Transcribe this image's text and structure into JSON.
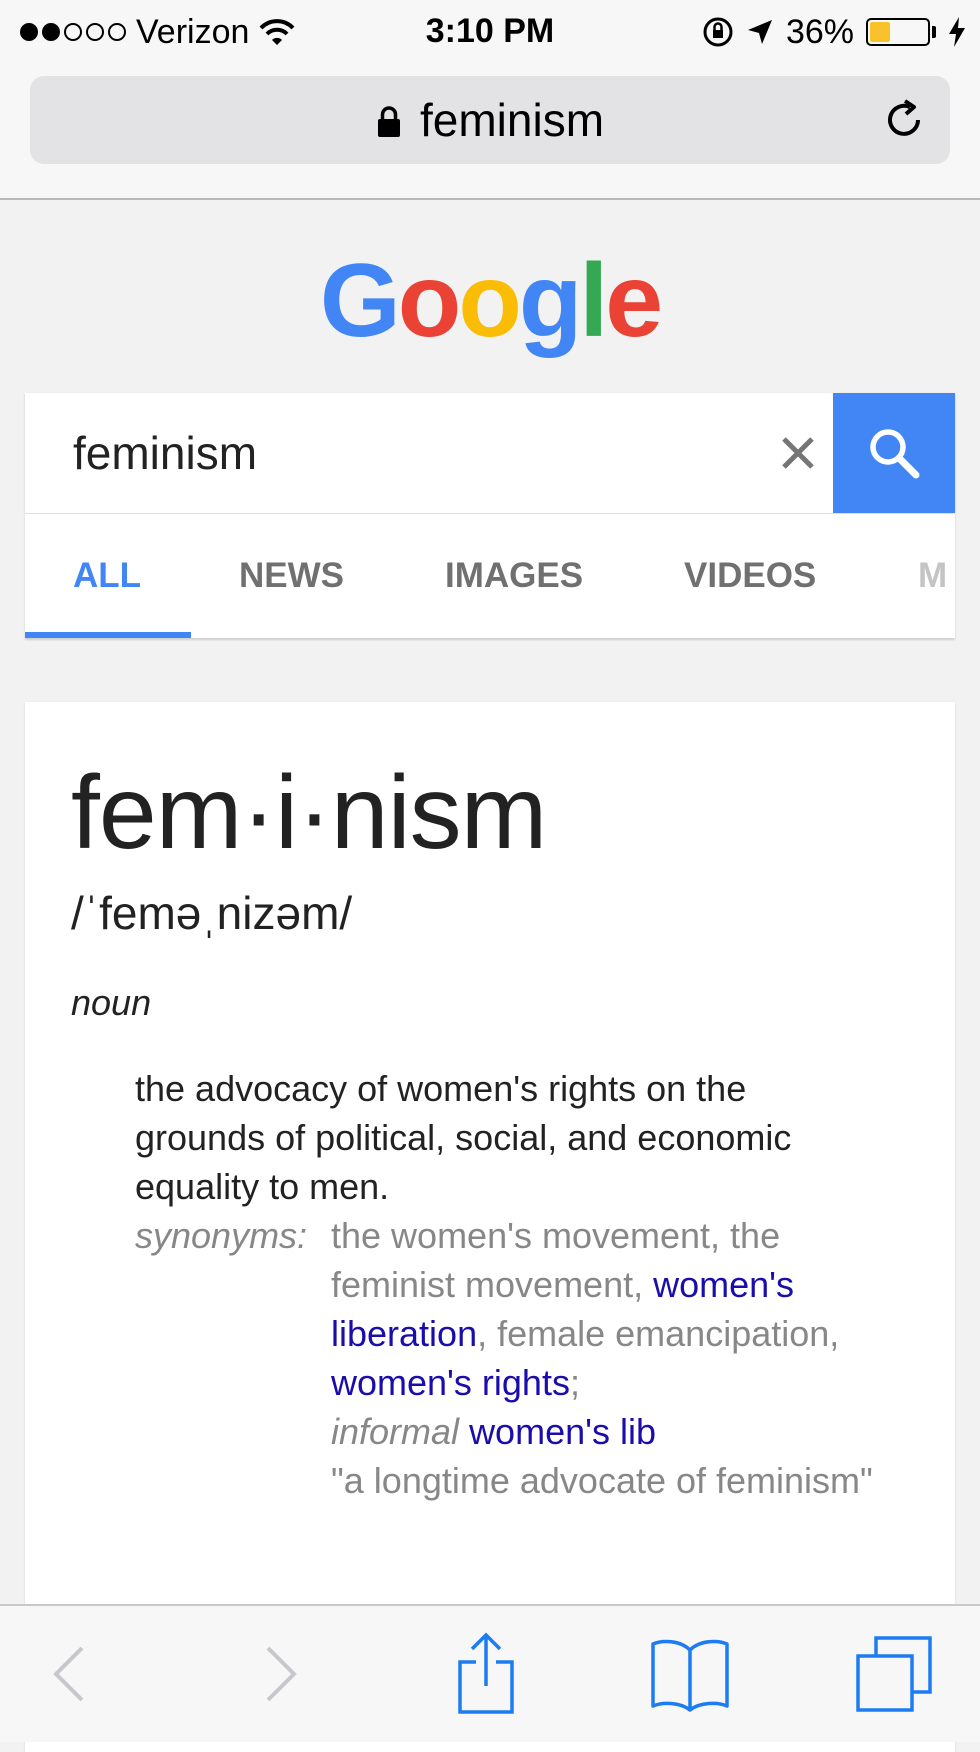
{
  "status_bar": {
    "carrier": "Verizon",
    "signal_strength": 2,
    "signal_total": 5,
    "time": "3:10 PM",
    "battery_percent_text": "36%",
    "battery_level": 0.36,
    "battery_color": "#f7c22b"
  },
  "url_bar": {
    "text": "feminism"
  },
  "logo": {
    "letters": [
      "G",
      "o",
      "o",
      "g",
      "l",
      "e"
    ],
    "colors": [
      "#4285f4",
      "#ea4335",
      "#fbbc05",
      "#4285f4",
      "#34a853",
      "#ea4335"
    ]
  },
  "search": {
    "query": "feminism",
    "accent_color": "#4285f4"
  },
  "tabs": [
    "ALL",
    "NEWS",
    "IMAGES",
    "VIDEOS",
    "M"
  ],
  "active_tab": "ALL",
  "definition": {
    "headword": "fem·i·nism",
    "pronunciation": "/ˈfeməˌnizəm/",
    "part_of_speech": "noun",
    "meaning": "the advocacy of women's rights on the grounds of political, social, and economic equality to men.",
    "synonyms_label": "synonyms:",
    "syn_plain_1": "the women's movement, the feminist movement, ",
    "syn_link_1": "women's liberation",
    "syn_plain_2": ", female emancipation, ",
    "syn_link_2": "women's rights",
    "syn_plain_3": ";",
    "informal_label": "informal",
    "syn_link_3": "women's lib",
    "example": "\"a longtime advocate of feminism\""
  },
  "toolbar_icons": [
    "back-icon",
    "forward-icon",
    "share-icon",
    "bookmarks-icon",
    "tabs-icon"
  ]
}
